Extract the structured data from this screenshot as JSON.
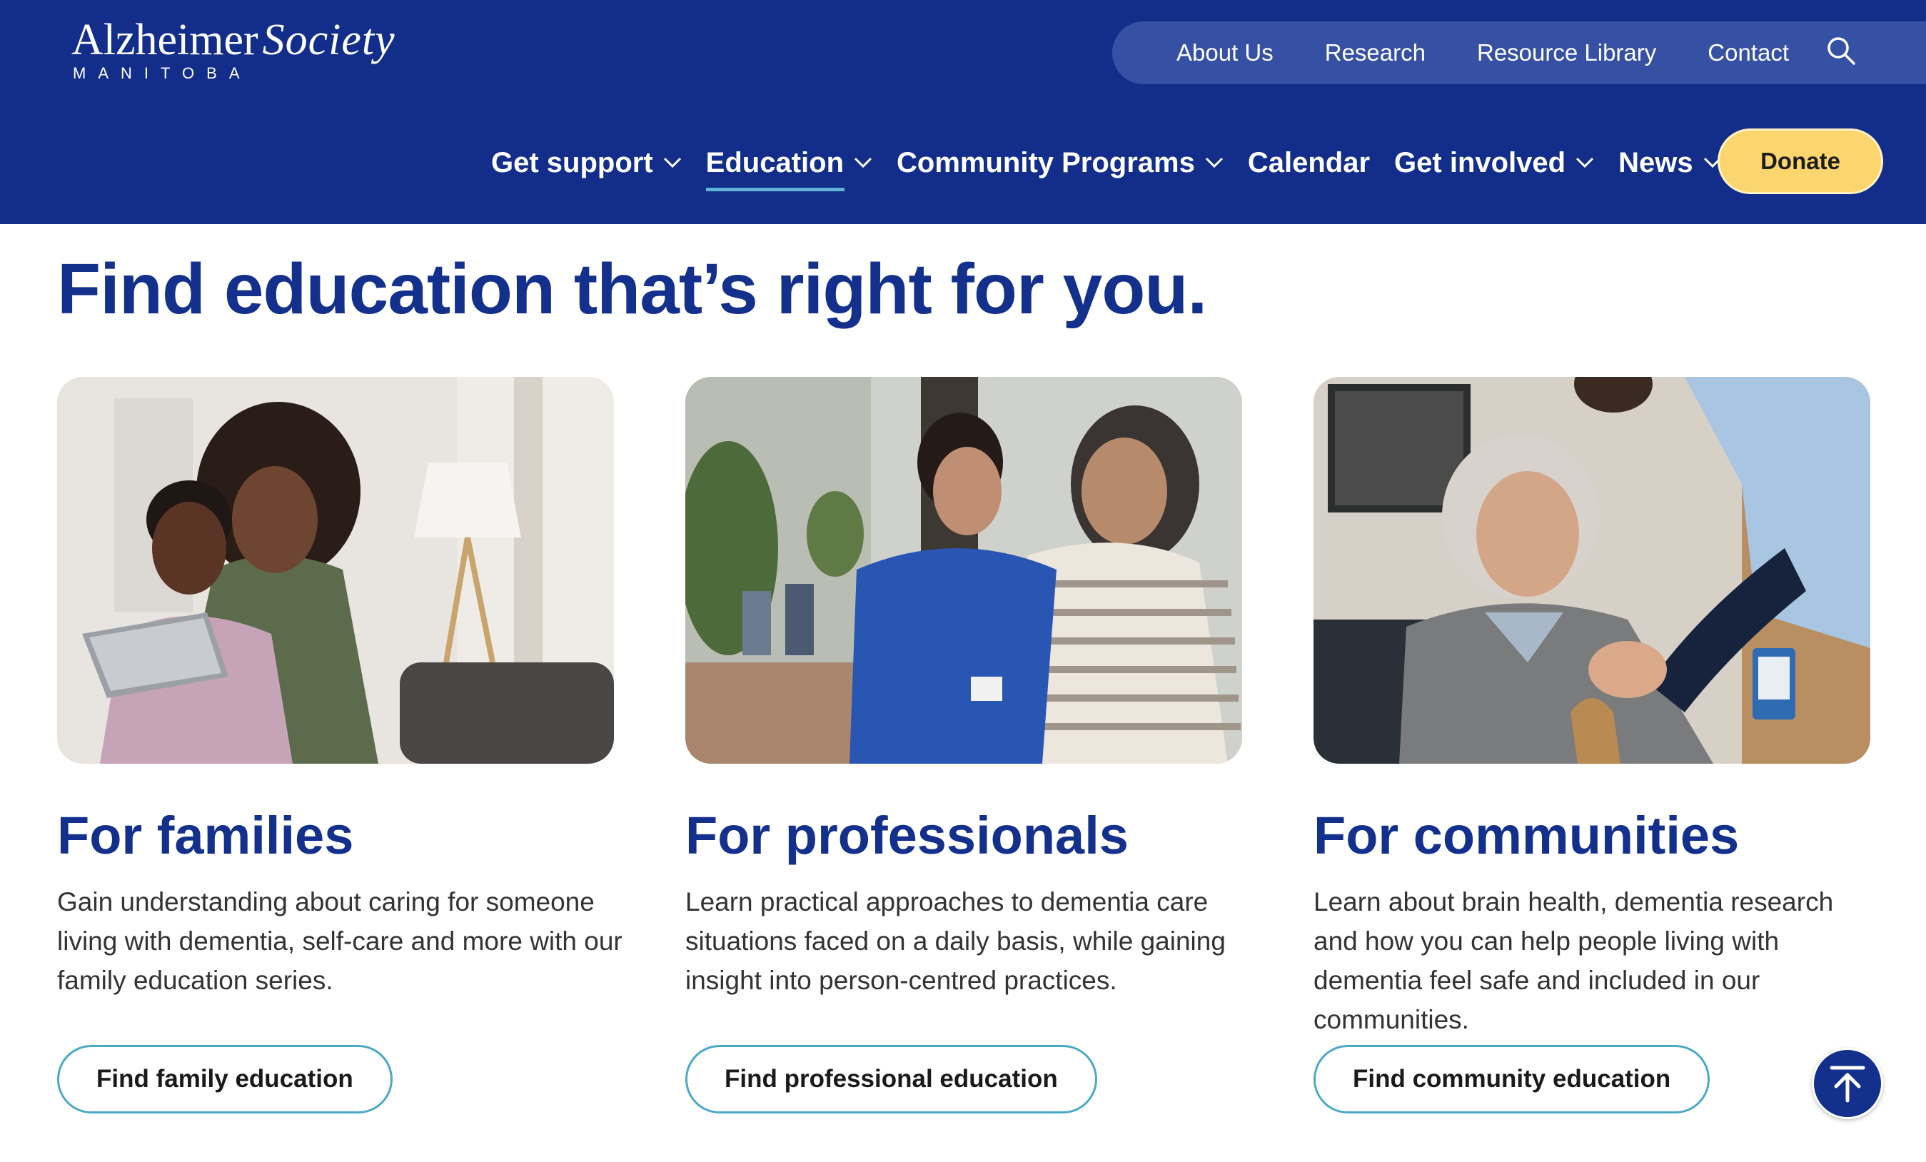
{
  "logo": {
    "name_part1": "Alzheimer",
    "name_part2": "Society",
    "region": "MANITOBA"
  },
  "utility_nav": [
    {
      "label": "About Us"
    },
    {
      "label": "Research"
    },
    {
      "label": "Resource Library"
    },
    {
      "label": "Contact"
    }
  ],
  "search": {
    "icon": "search-icon"
  },
  "main_nav": [
    {
      "label": "Get support",
      "has_dropdown": true
    },
    {
      "label": "Education",
      "has_dropdown": true,
      "active": true
    },
    {
      "label": "Community Programs",
      "has_dropdown": true
    },
    {
      "label": "Calendar",
      "has_dropdown": false
    },
    {
      "label": "Get involved",
      "has_dropdown": true
    },
    {
      "label": "News",
      "has_dropdown": true
    }
  ],
  "donate": {
    "label": "Donate"
  },
  "page_title": "Find education that’s right for you.",
  "cards": [
    {
      "title": "For families",
      "text": "Gain understanding about caring for someone living with dementia, self-care and more with our family education series.",
      "button": "Find family education",
      "image": "photo-woman-and-elderly-mother-with-tablet"
    },
    {
      "title": "For professionals",
      "text": "Learn practical approaches to dementia care situations faced on a daily basis, while gaining insight into person-centred practices.",
      "button": "Find professional education",
      "image": "photo-nurse-and-senior-woman-smiling"
    },
    {
      "title": "For communities",
      "text": "Learn about brain health, dementia research and how you can help people living with dementia feel safe and included in our communities.",
      "button": "Find community education",
      "image": "photo-caregiver-helping-senior-woman-with-cane"
    }
  ],
  "colors": {
    "header_bg": "#122e8a",
    "utility_bar_bg": "#3650a3",
    "heading": "#13308c",
    "donate_bg": "#fbd66e",
    "button_border": "#4aa9c7",
    "active_underline": "#5fb5d8"
  },
  "back_to_top": {
    "icon": "arrow-up-icon"
  }
}
